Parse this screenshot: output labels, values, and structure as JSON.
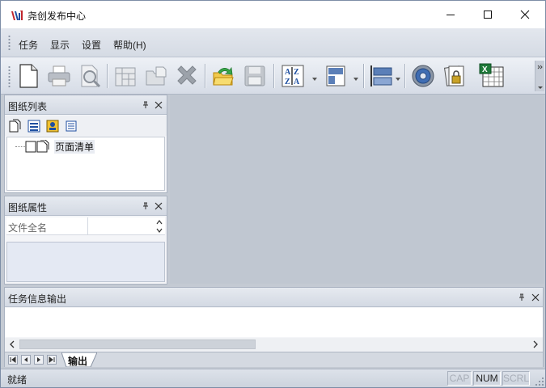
{
  "window": {
    "title": "尧创发布中心"
  },
  "menubar": {
    "items": [
      "任务",
      "显示",
      "设置",
      "帮助(H)"
    ]
  },
  "toolbar": {
    "buttons": [
      "new-document-icon",
      "print-icon",
      "print-preview-icon",
      "sheet-layout-icon",
      "open-folder-icon",
      "delete-icon",
      "refresh-publish-icon",
      "save-icon",
      "sort-az-icon",
      "layout-vertical-icon",
      "layout-horizontal-icon",
      "settings-disc-icon",
      "secure-archive-icon",
      "excel-export-icon"
    ]
  },
  "sheet_list": {
    "title": "图纸列表",
    "tree_item": "页面清单"
  },
  "sheet_props": {
    "title": "图纸属性",
    "row_label": "文件全名"
  },
  "output": {
    "title": "任务信息输出",
    "tab": "输出"
  },
  "statusbar": {
    "text": "就绪",
    "cap": "CAP",
    "num": "NUM",
    "scrl": "SCRL"
  },
  "colors": {
    "workspace": "#c0c7d1",
    "panel_header": "#d3d9e3",
    "window_border": "#7d8da6"
  }
}
